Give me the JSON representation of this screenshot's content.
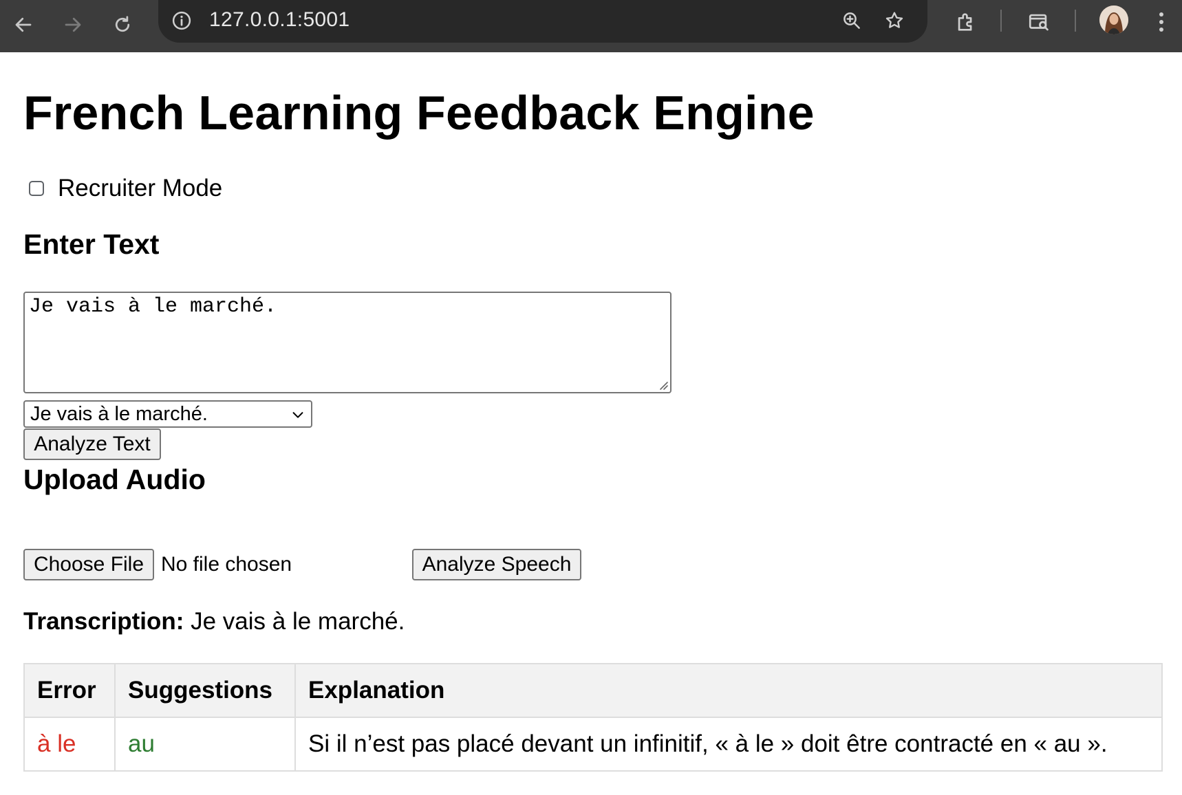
{
  "browser": {
    "url": "127.0.0.1:5001"
  },
  "header": {
    "title": "French Learning Feedback Engine"
  },
  "recruiter_mode": {
    "label": "Recruiter Mode",
    "checked": false
  },
  "text_section": {
    "heading": "Enter Text",
    "textarea_value": "Je vais à le marché.",
    "select_value": "Je vais à le marché.",
    "analyze_button": "Analyze Text"
  },
  "audio_section": {
    "heading": "Upload Audio",
    "choose_file_button": "Choose File",
    "file_status": "No file chosen",
    "analyze_button": "Analyze Speech"
  },
  "transcription": {
    "label": "Transcription:",
    "value": "Je vais à le marché."
  },
  "results_table": {
    "headers": [
      "Error",
      "Suggestions",
      "Explanation"
    ],
    "rows": [
      {
        "error": "à le",
        "suggestion": "au",
        "explanation": "Si il n’est pas placé devant un infinitif, « à le » doit être contracté en « au »."
      }
    ]
  },
  "colors": {
    "chrome_bg": "#3c3c3c",
    "omnibox_bg": "#282828",
    "error_text": "#d93025",
    "suggestion_text": "#2e7d32",
    "table_header_bg": "#f2f2f2"
  }
}
